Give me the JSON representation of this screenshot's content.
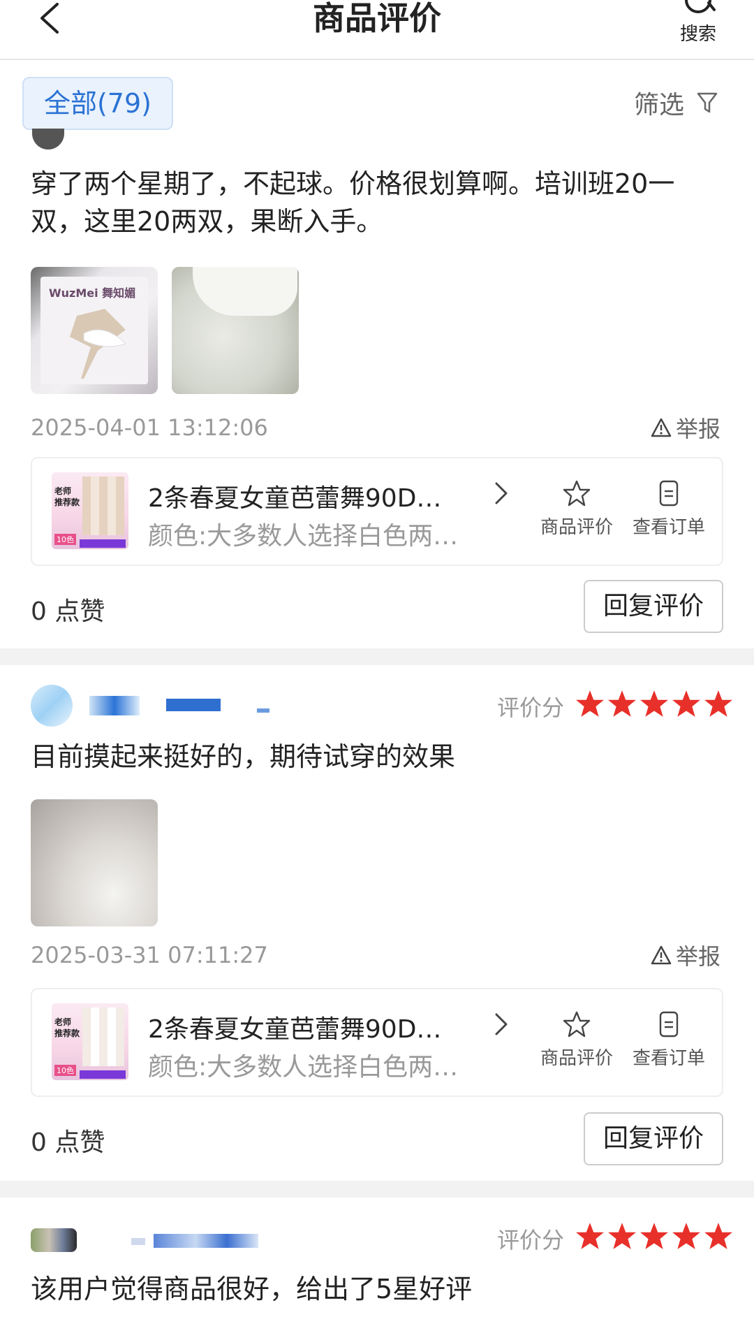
{
  "header": {
    "title": "商品评价",
    "search_label": "搜索"
  },
  "filter": {
    "tab_all": "全部(79)",
    "filter_label": "筛选"
  },
  "reviews": [
    {
      "text": "穿了两个星期了，不起球。价格很划算啊。培训班20一双，这里20两双，果断入手。",
      "timestamp": "2025-04-01 13:12:06",
      "report": "举报",
      "product_name": "2条春夏女童芭蕾舞90D…",
      "product_variant": "颜色:大多数人选择白色两双…",
      "action_review": "商品评价",
      "action_order": "查看订单",
      "likes": "0 点赞",
      "reply": "回复评价"
    },
    {
      "score_label": "评价分",
      "stars": 5,
      "text": "目前摸起来挺好的，期待试穿的效果",
      "timestamp": "2025-03-31 07:11:27",
      "report": "举报",
      "product_name": "2条春夏女童芭蕾舞90D…",
      "product_variant": "颜色:大多数人选择白色两双…",
      "action_review": "商品评价",
      "action_order": "查看订单",
      "likes": "0 点赞",
      "reply": "回复评价"
    },
    {
      "score_label": "评价分",
      "stars": 5,
      "text": "该用户觉得商品很好，给出了5星好评"
    }
  ],
  "product_thumb_text": {
    "badge_top": "老师",
    "badge_mid": "推荐款",
    "badge_bottom": "10色"
  },
  "photo_text": {
    "brand": "WuzMei 舞知媚"
  },
  "colors": {
    "accent_blue": "#2a72d4",
    "star_red": "#e8302a",
    "muted_gray": "#999999"
  }
}
